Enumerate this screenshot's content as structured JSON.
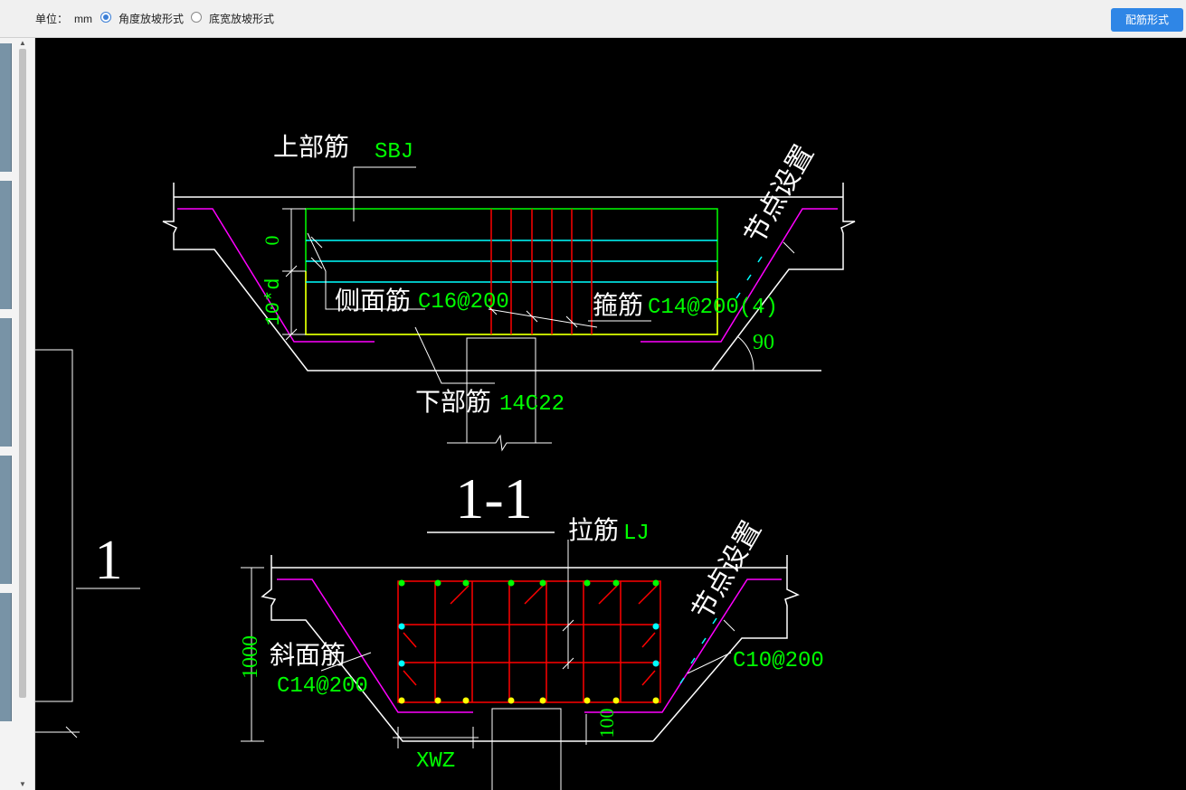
{
  "toolbar": {
    "unit_label": "单位：",
    "unit_value": "mm",
    "options": [
      {
        "label": "角度放坡形式",
        "selected": true
      },
      {
        "label": "底宽放坡形式",
        "selected": false
      }
    ],
    "config_button": "配筋形式"
  },
  "drawing": {
    "section1": {
      "top_bar_label": "上部筋",
      "top_bar_code": "SBJ",
      "dim_zero": "0",
      "dim_10d": "10*d",
      "side_bar_label": "侧面筋",
      "side_bar_spec": "C16@200",
      "stirrup_label": "箍筋",
      "stirrup_spec": "C14@200(4)",
      "angle": "90",
      "bottom_bar_label": "下部筋",
      "bottom_bar_spec": "14C22",
      "node_label": "节点设置"
    },
    "section_title": "1-1",
    "left_mark": "1",
    "section2": {
      "tie_label": "拉筋",
      "tie_code": "LJ",
      "node_label": "节点设置",
      "dim_height": "1000",
      "slope_label": "斜面筋",
      "slope_spec": "C14@200",
      "right_spec": "C10@200",
      "dim_100": "100",
      "xwz": "XWZ"
    }
  },
  "colors": {
    "white": "#ffffff",
    "green": "#00ff00",
    "red": "#ff0000",
    "cyan": "#00ffff",
    "yellow": "#ffff00",
    "magenta": "#ff00ff",
    "accent": "#2f86e6"
  }
}
